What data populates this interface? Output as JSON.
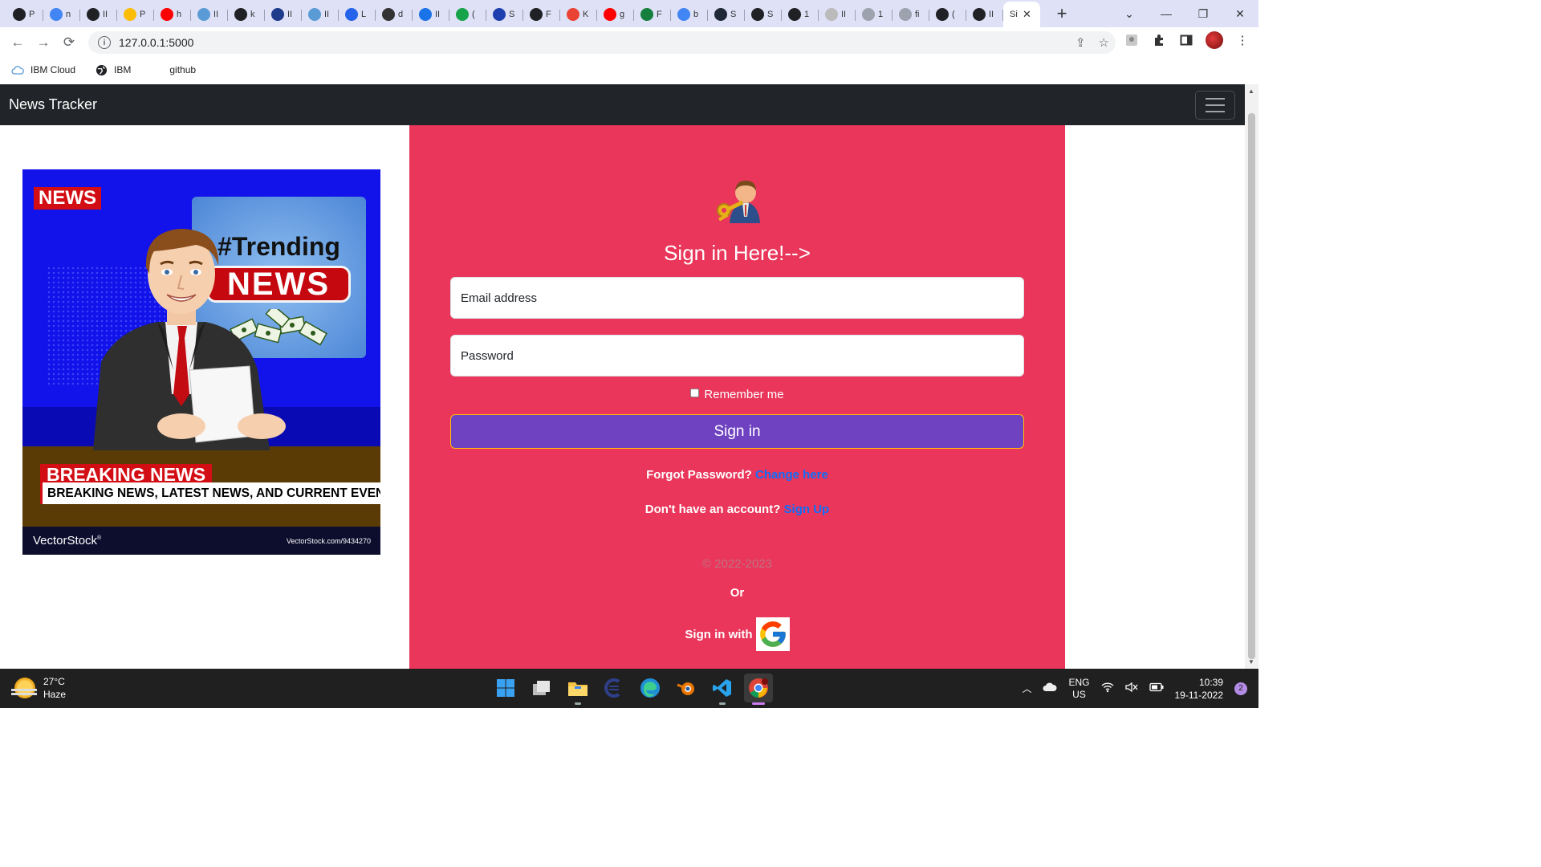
{
  "browser": {
    "tabs": [
      {
        "title": "P",
        "icon": "globe-icon",
        "color": "#202124"
      },
      {
        "title": "n",
        "icon": "google-icon",
        "color": "#4285f4"
      },
      {
        "title": "II",
        "icon": "globe-icon",
        "color": "#202124"
      },
      {
        "title": "P",
        "icon": "drive-icon",
        "color": "#fbbc04"
      },
      {
        "title": "h",
        "icon": "youtube-icon",
        "color": "#ff0000"
      },
      {
        "title": "II",
        "icon": "cloud-icon",
        "color": "#5b9bd5"
      },
      {
        "title": "k",
        "icon": "globe-icon",
        "color": "#202124"
      },
      {
        "title": "II",
        "icon": "grid-icon",
        "color": "#1e3a8a"
      },
      {
        "title": "II",
        "icon": "cloud-icon",
        "color": "#5b9bd5"
      },
      {
        "title": "L",
        "icon": "people-icon",
        "color": "#2563eb"
      },
      {
        "title": "d",
        "icon": "bike-icon",
        "color": "#333333"
      },
      {
        "title": "II",
        "icon": "book-icon",
        "color": "#1a73e8"
      },
      {
        "title": "(",
        "icon": "dollar-icon",
        "color": "#16a34a"
      },
      {
        "title": "S",
        "icon": "shield-icon",
        "color": "#1e40af"
      },
      {
        "title": "F",
        "icon": "globe-dark-icon",
        "color": "#202124"
      },
      {
        "title": "K",
        "icon": "gmail-icon",
        "color": "#ea4335"
      },
      {
        "title": "g",
        "icon": "youtube-icon",
        "color": "#ff0000"
      },
      {
        "title": "F",
        "icon": "w-icon",
        "color": "#15803d"
      },
      {
        "title": "b",
        "icon": "google-icon",
        "color": "#4285f4"
      },
      {
        "title": "S",
        "icon": "tds-icon",
        "color": "#1f2937"
      },
      {
        "title": "S",
        "icon": "globe-icon",
        "color": "#202124"
      },
      {
        "title": "1",
        "icon": "globe-icon",
        "color": "#202124"
      },
      {
        "title": "II",
        "icon": "github-icon",
        "color": "#bbbbbb"
      },
      {
        "title": "1",
        "icon": "globe-icon",
        "color": "#9ca3af"
      },
      {
        "title": "fi",
        "icon": "globe-icon",
        "color": "#9ca3af"
      },
      {
        "title": "(",
        "icon": "globe-icon",
        "color": "#202124"
      },
      {
        "title": "II",
        "icon": "globe-icon",
        "color": "#202124"
      }
    ],
    "active_tab_title": "Si",
    "new_tab_label": "+",
    "url": "127.0.0.1:5000",
    "bookmarks": [
      {
        "label": "IBM Cloud",
        "icon": "cloud-icon"
      },
      {
        "label": "IBM",
        "icon": "globe-icon"
      },
      {
        "label": "github",
        "icon": "blank-icon"
      }
    ]
  },
  "navbar": {
    "brand": "News Tracker"
  },
  "hero_image": {
    "tag": "NEWS",
    "trend_text": "#Trending",
    "trend_box": "NEWS",
    "breaking_title": "BREAKING NEWS",
    "breaking_subtitle": "BREAKING NEWS, LATEST NEWS, AND CURRENT EVENTS",
    "watermark_logo": "VectorStock",
    "watermark_mark": "®",
    "watermark_url": "VectorStock.com/9434270"
  },
  "login": {
    "heading": "Sign in Here!-->",
    "email_placeholder": "Email address",
    "password_placeholder": "Password",
    "remember_label": "Remember me",
    "signin_button": "Sign in",
    "forgot_text": "Forgot Password?",
    "forgot_link": "Change here",
    "no_account_text": "Don't have an account?",
    "signup_link": "Sign Up",
    "copyright": "© 2022-2023",
    "or_text": "Or",
    "google_text": "Sign in with"
  },
  "taskbar": {
    "weather_temp": "27°C",
    "weather_desc": "Haze",
    "lang_line1": "ENG",
    "lang_line2": "US",
    "time": "10:39",
    "date": "19-11-2022",
    "notification_count": "2"
  },
  "colors": {
    "panel": "#e9365a",
    "button": "#6f42c1",
    "link": "#0d6efd",
    "navbar": "#212529"
  }
}
